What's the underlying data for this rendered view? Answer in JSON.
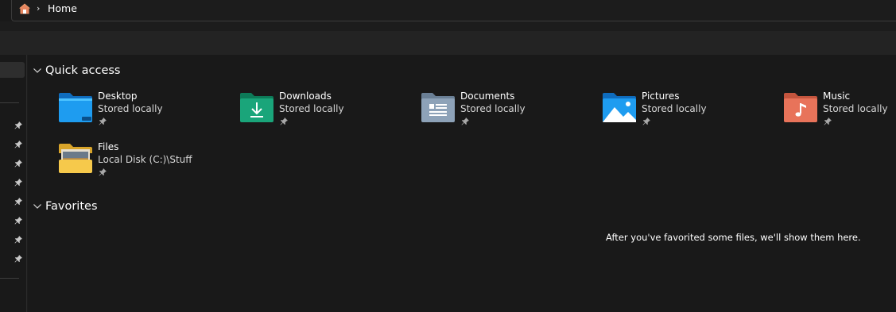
{
  "address_bar": {
    "home_icon": "home-icon",
    "separator": "›",
    "breadcrumb": "Home"
  },
  "quick_access": {
    "title": "Quick access",
    "items": [
      {
        "name": "Desktop",
        "subtitle": "Stored locally",
        "icon": "desktop-folder-icon",
        "pinned": true
      },
      {
        "name": "Downloads",
        "subtitle": "Stored locally",
        "icon": "downloads-folder-icon",
        "pinned": true
      },
      {
        "name": "Documents",
        "subtitle": "Stored locally",
        "icon": "documents-folder-icon",
        "pinned": true
      },
      {
        "name": "Pictures",
        "subtitle": "Stored locally",
        "icon": "pictures-folder-icon",
        "pinned": true
      },
      {
        "name": "Music",
        "subtitle": "Stored locally",
        "icon": "music-folder-icon",
        "pinned": true
      },
      {
        "name": "Files",
        "subtitle": "Local Disk (C:)\\Stuff",
        "icon": "files-folder-icon",
        "pinned": true
      }
    ]
  },
  "favorites": {
    "title": "Favorites",
    "empty_message": "After you've favorited some files, we'll show them here."
  },
  "colors": {
    "background": "#191919",
    "toolbar": "#232323",
    "accent_blue": "#1e9cf0",
    "downloads_teal": "#1aa57a",
    "documents_gray": "#8da2b8",
    "music_orange": "#e8735a",
    "files_yellow": "#f6c94b"
  }
}
